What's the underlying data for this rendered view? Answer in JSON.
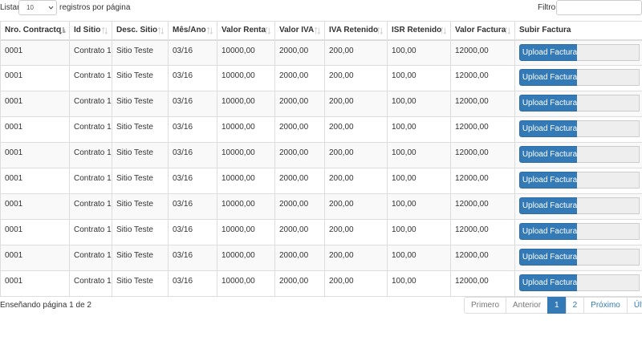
{
  "length_menu": {
    "prefix": "Listar",
    "value": "10",
    "suffix": "registros por página"
  },
  "filter": {
    "label": "Filtro",
    "value": ""
  },
  "table": {
    "columns": [
      "Nro. Contracto",
      "Id Sitio",
      "Desc. Sitio",
      "Mês/Ano",
      "Valor Renta",
      "Valor IVA",
      "IVA Retenido",
      "ISR Retenido",
      "Valor Factura",
      "Subir Factura"
    ],
    "rows": [
      [
        "0001",
        "Contrato 1",
        "Sitio Teste",
        "03/16",
        "10000,00",
        "2000,00",
        "200,00",
        "100,00",
        "12000,00"
      ],
      [
        "0001",
        "Contrato 1",
        "Sitio Teste",
        "03/16",
        "10000,00",
        "2000,00",
        "200,00",
        "100,00",
        "12000,00"
      ],
      [
        "0001",
        "Contrato 1",
        "Sitio Teste",
        "03/16",
        "10000,00",
        "2000,00",
        "200,00",
        "100,00",
        "12000,00"
      ],
      [
        "0001",
        "Contrato 1",
        "Sitio Teste",
        "03/16",
        "10000,00",
        "2000,00",
        "200,00",
        "100,00",
        "12000,00"
      ],
      [
        "0001",
        "Contrato 1",
        "Sitio Teste",
        "03/16",
        "10000,00",
        "2000,00",
        "200,00",
        "100,00",
        "12000,00"
      ],
      [
        "0001",
        "Contrato 1",
        "Sitio Teste",
        "03/16",
        "10000,00",
        "2000,00",
        "200,00",
        "100,00",
        "12000,00"
      ],
      [
        "0001",
        "Contrato 1",
        "Sitio Teste",
        "03/16",
        "10000,00",
        "2000,00",
        "200,00",
        "100,00",
        "12000,00"
      ],
      [
        "0001",
        "Contrato 1",
        "Sitio Teste",
        "03/16",
        "10000,00",
        "2000,00",
        "200,00",
        "100,00",
        "12000,00"
      ],
      [
        "0001",
        "Contrato 1",
        "Sitio Teste",
        "03/16",
        "10000,00",
        "2000,00",
        "200,00",
        "100,00",
        "12000,00"
      ],
      [
        "0001",
        "Contrato 1",
        "Sitio Teste",
        "03/16",
        "10000,00",
        "2000,00",
        "200,00",
        "100,00",
        "12000,00"
      ]
    ],
    "upload_label": "Upload Factura",
    "upload_icon": "file-upload",
    "sort_icon": "sort-icon",
    "active_sort_icon": "sort-ascending-icon"
  },
  "footer": {
    "info": "Enseñando página 1 de 2"
  },
  "pagination": {
    "first": "Primero",
    "previous": "Anterior",
    "pages": [
      "1",
      "2"
    ],
    "current": "1",
    "next": "Próximo",
    "last": "Último"
  },
  "colors": {
    "primary": "#337ab7",
    "border": "#dddddd",
    "stripe": "#f9f9f9",
    "input_bg": "#eeeeee"
  }
}
